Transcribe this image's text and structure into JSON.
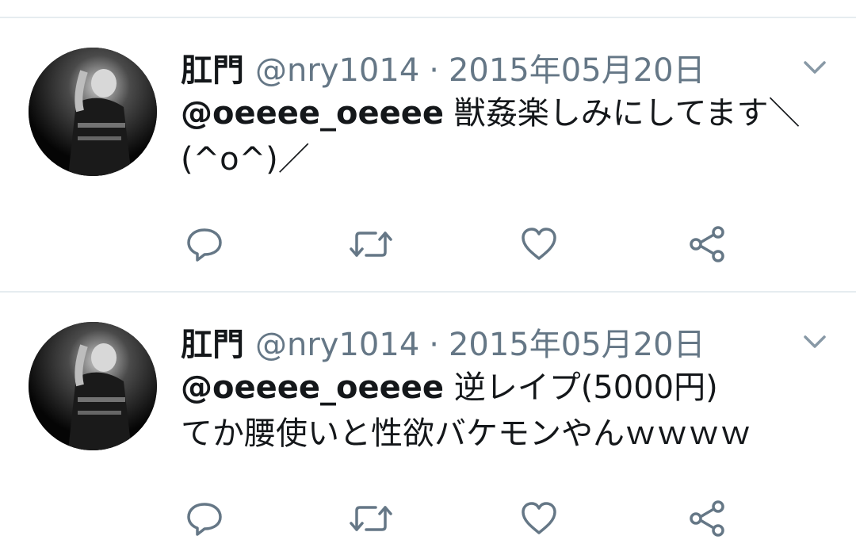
{
  "tweets": [
    {
      "name": "肛門",
      "handle": "@nry1014",
      "separator": "·",
      "date": "2015年05月20日",
      "mention": "@oeeee_oeeee",
      "text_line1": "獣姦楽しみにしてます＼",
      "text_line2": "(^o^)／"
    },
    {
      "name": "肛門",
      "handle": "@nry1014",
      "separator": "·",
      "date": "2015年05月20日",
      "mention": "@oeeee_oeeee",
      "text_line1": "逆レイプ(5000円)",
      "text_line2": "てか腰使いと性欲バケモンやんｗｗｗｗ"
    }
  ],
  "icons": {
    "reply": "reply-icon",
    "retweet": "retweet-icon",
    "like": "heart-icon",
    "share": "share-icon",
    "menu": "chevron-down-icon"
  },
  "colors": {
    "text": "#14171a",
    "secondary": "#657786",
    "divider": "#e6ecf0"
  }
}
